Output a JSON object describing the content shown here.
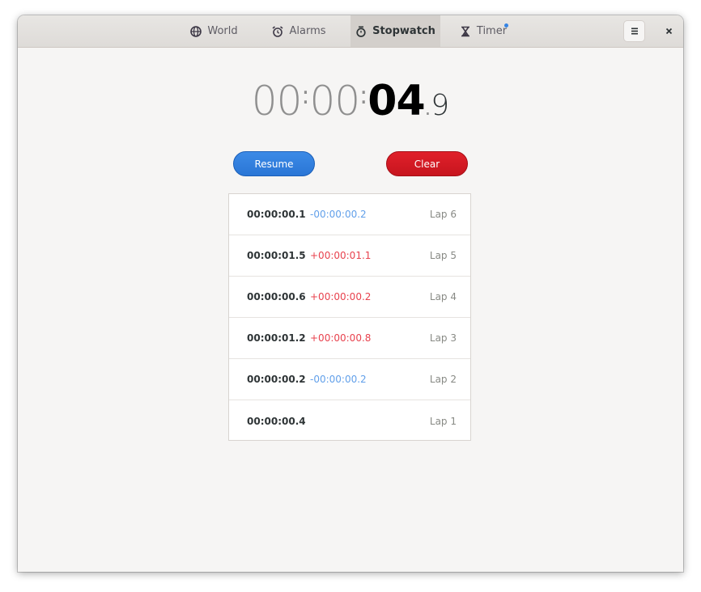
{
  "tabs": [
    {
      "label": "World",
      "icon": "globe-icon",
      "active": false
    },
    {
      "label": "Alarms",
      "icon": "alarm-clock-icon",
      "active": false
    },
    {
      "label": "Stopwatch",
      "icon": "stopwatch-icon",
      "active": true
    },
    {
      "label": "Timer",
      "icon": "hourglass-icon",
      "active": false,
      "indicator": true
    }
  ],
  "header": {
    "menu_icon": "hamburger-menu-icon",
    "close_icon": "close-icon"
  },
  "stopwatch": {
    "hours": "00",
    "minutes": "00",
    "seconds": "04",
    "tenths": "9",
    "sep": ":",
    "dec_sep": "."
  },
  "buttons": {
    "resume": "Resume",
    "clear": "Clear"
  },
  "colors": {
    "accent": "#3584e4",
    "destructive": "#e01b24",
    "negative_diff": "#62a0ea",
    "positive_diff": "#e8424e"
  },
  "laps": [
    {
      "total": "00:00:00.1",
      "diff": "-00:00:00.2",
      "diff_type": "neg",
      "label": "Lap 6"
    },
    {
      "total": "00:00:01.5",
      "diff": "+00:00:01.1",
      "diff_type": "pos",
      "label": "Lap 5"
    },
    {
      "total": "00:00:00.6",
      "diff": "+00:00:00.2",
      "diff_type": "pos",
      "label": "Lap 4"
    },
    {
      "total": "00:00:01.2",
      "diff": "+00:00:00.8",
      "diff_type": "pos",
      "label": "Lap 3"
    },
    {
      "total": "00:00:00.2",
      "diff": "-00:00:00.2",
      "diff_type": "neg",
      "label": "Lap 2"
    },
    {
      "total": "00:00:00.4",
      "diff": "",
      "diff_type": "",
      "label": "Lap 1"
    }
  ]
}
